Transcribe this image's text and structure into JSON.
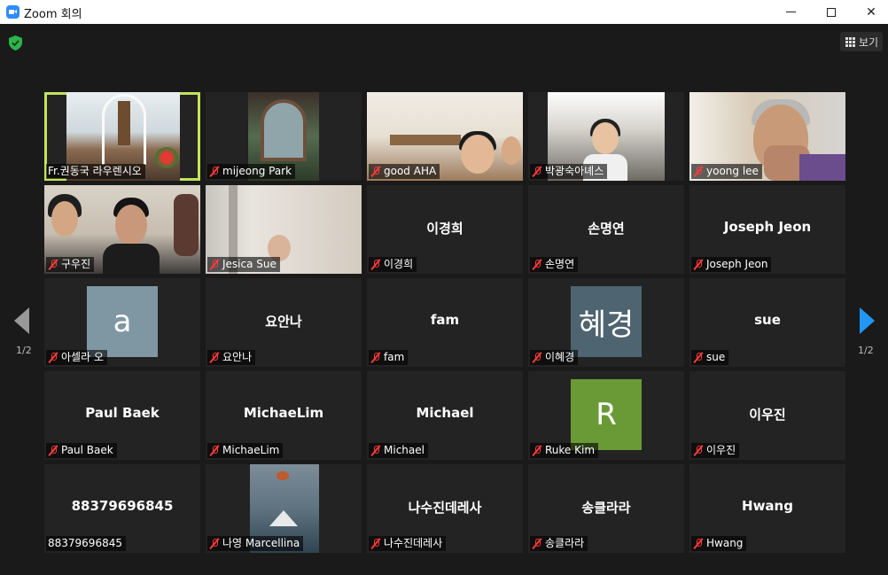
{
  "window": {
    "title": "Zoom 회의"
  },
  "toolbar": {
    "view_label": "보기"
  },
  "pagination": {
    "left_label": "1/2",
    "right_label": "1/2"
  },
  "colors": {
    "active_speaker_border": "#c2e35c",
    "muted_mic": "#ff3b3b",
    "next_arrow": "#2196f3",
    "shield": "#2fb34a"
  },
  "tiles": [
    {
      "label": "Fr.권동국 라우렌시오",
      "muted": false,
      "active": true,
      "video": "church"
    },
    {
      "label": "mijeong Park",
      "muted": true,
      "video": "grotto"
    },
    {
      "label": "good AHA",
      "muted": true,
      "video": "family"
    },
    {
      "label": "박광숙아녜스",
      "muted": true,
      "video": "office"
    },
    {
      "label": "yoong lee",
      "muted": true,
      "video": "old"
    },
    {
      "label": "구우진",
      "muted": true,
      "video": "couple"
    },
    {
      "label": "Jesica Sue",
      "muted": true,
      "video": "room"
    },
    {
      "label": "이경희",
      "center": "이경희",
      "muted": true
    },
    {
      "label": "손명연",
      "center": "손명연",
      "muted": true
    },
    {
      "label": "Joseph Jeon",
      "center": "Joseph Jeon",
      "muted": true
    },
    {
      "label": "아셀라 오",
      "avatar": "a",
      "avatar_color": "#7e97a3",
      "muted": true
    },
    {
      "label": "요안나",
      "center": "요안나",
      "muted": true
    },
    {
      "label": "fam",
      "center": "fam",
      "muted": true
    },
    {
      "label": "이혜경",
      "avatar": "혜경",
      "avatar_color": "#4e6470",
      "muted": true
    },
    {
      "label": "sue",
      "center": "sue",
      "muted": true
    },
    {
      "label": "Paul Baek",
      "center": "Paul Baek",
      "muted": true
    },
    {
      "label": "MichaeLim",
      "center": "MichaeLim",
      "muted": true
    },
    {
      "label": "Michael",
      "center": "Michael",
      "muted": true
    },
    {
      "label": "Ruke Kim",
      "avatar": "R",
      "avatar_color": "#6a9a35",
      "muted": true
    },
    {
      "label": "이우진",
      "center": "이우진",
      "muted": true
    },
    {
      "label": "88379696845",
      "center": "88379696845",
      "muted": false
    },
    {
      "label": "나영 Marcellina",
      "muted": true,
      "video": "boat"
    },
    {
      "label": "나수진데레사",
      "center": "나수진데레사",
      "muted": true
    },
    {
      "label": "송클라라",
      "center": "송클라라",
      "muted": true
    },
    {
      "label": "Hwang",
      "center": "Hwang",
      "muted": true
    }
  ]
}
